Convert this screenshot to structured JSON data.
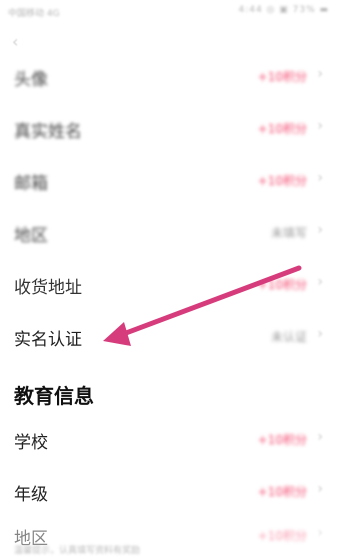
{
  "status_bar": {
    "carrier": "中国移动 4G",
    "icons": "4:44 ◎ ▣ 73% ▬"
  },
  "back_icon": "chevron-left-icon",
  "rows": [
    {
      "label": "头像",
      "value": "+10积分",
      "value_type": "accent"
    },
    {
      "label": "真实姓名",
      "value": "+10积分",
      "value_type": "accent"
    },
    {
      "label": "邮箱",
      "value": "+10积分",
      "value_type": "accent"
    },
    {
      "label": "地区",
      "value": "未填写",
      "value_type": "grey"
    },
    {
      "label": "收货地址",
      "value": "+10积分",
      "value_type": "accent"
    },
    {
      "label": "实名认证",
      "value": "未认证",
      "value_type": "grey"
    }
  ],
  "education": {
    "title": "教育信息",
    "rows": [
      {
        "label": "学校",
        "value": "+10积分",
        "value_type": "accent"
      },
      {
        "label": "年级",
        "value": "+10积分",
        "value_type": "accent"
      },
      {
        "label": "地区",
        "value": "+10积分",
        "value_type": "accent"
      }
    ]
  },
  "footer_note": "温馨提示，认真填写资料有奖励",
  "colors": {
    "accent": "#f3476d",
    "annotation_arrow": "#d63c7c"
  }
}
